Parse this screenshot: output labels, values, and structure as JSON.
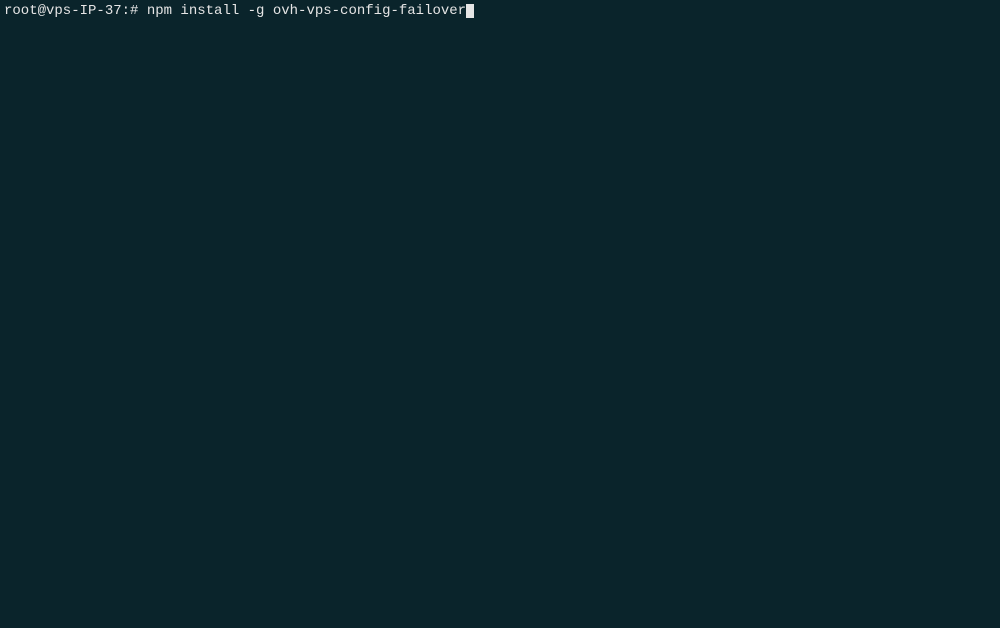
{
  "terminal": {
    "prompt": "root@vps-IP-37:# ",
    "command": "npm install -g ovh-vps-config-failover"
  }
}
